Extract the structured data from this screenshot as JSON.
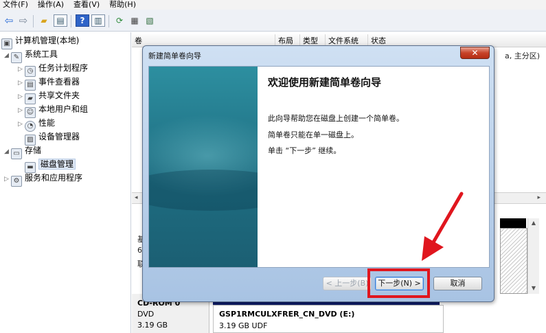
{
  "menubar": {
    "items": [
      "文件(F)",
      "操作(A)",
      "查看(V)",
      "帮助(H)"
    ]
  },
  "toolbar": {
    "icons": [
      "back-arrow-icon",
      "forward-arrow-icon",
      "folder-icon",
      "console-tree-icon",
      "help-icon",
      "show-hide-icon",
      "refresh-icon",
      "properties-icon",
      "export-icon"
    ],
    "help_glyph": "?"
  },
  "tree": {
    "root": "计算机管理(本地)",
    "system_tools": "系统工具",
    "task_scheduler": "任务计划程序",
    "event_viewer": "事件查看器",
    "shared_folders": "共享文件夹",
    "local_users": "本地用户和组",
    "performance": "性能",
    "device_manager": "设备管理器",
    "storage": "存储",
    "disk_management": "磁盘管理",
    "services": "服务和应用程序"
  },
  "columns": {
    "volume": "卷",
    "layout": "布局",
    "type": "类型",
    "filesystem": "文件系统",
    "status": "状态"
  },
  "behind": {
    "status_tail": "a, 主分区)",
    "disk_prefix_1": "基",
    "disk_prefix_2": "6",
    "disk_prefix_3": "联"
  },
  "cdrom": {
    "label": "CD-ROM 0",
    "type": "DVD",
    "size": "3.19 GB",
    "volume_name": "GSP1RMCULXFRER_CN_DVD  (E:)",
    "volume_size": "3.19 GB UDF"
  },
  "dialog": {
    "title": "新建简单卷向导",
    "close_glyph": "✕",
    "heading": "欢迎使用新建简单卷向导",
    "line1": "此向导帮助您在磁盘上创建一个简单卷。",
    "line2": "简单卷只能在单一磁盘上。",
    "line3": "单击 “下一步” 继续。",
    "back_label": "< 上一步(B)",
    "next_label": "下一步(N) >",
    "cancel_label": "取消"
  },
  "colors": {
    "highlight": "#e0161e",
    "teal_panel": "#1f6f83"
  }
}
